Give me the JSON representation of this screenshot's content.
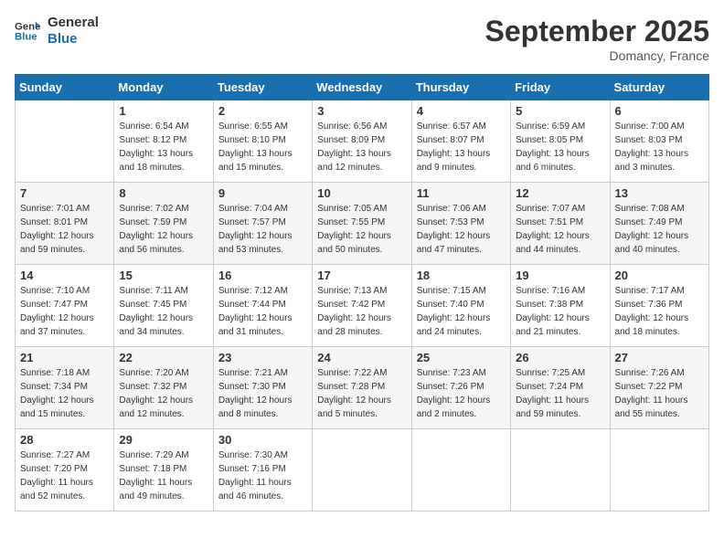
{
  "header": {
    "logo_line1": "General",
    "logo_line2": "Blue",
    "month": "September 2025",
    "location": "Domancy, France"
  },
  "days_of_week": [
    "Sunday",
    "Monday",
    "Tuesday",
    "Wednesday",
    "Thursday",
    "Friday",
    "Saturday"
  ],
  "weeks": [
    [
      {
        "day": "",
        "info": ""
      },
      {
        "day": "1",
        "info": "Sunrise: 6:54 AM\nSunset: 8:12 PM\nDaylight: 13 hours\nand 18 minutes."
      },
      {
        "day": "2",
        "info": "Sunrise: 6:55 AM\nSunset: 8:10 PM\nDaylight: 13 hours\nand 15 minutes."
      },
      {
        "day": "3",
        "info": "Sunrise: 6:56 AM\nSunset: 8:09 PM\nDaylight: 13 hours\nand 12 minutes."
      },
      {
        "day": "4",
        "info": "Sunrise: 6:57 AM\nSunset: 8:07 PM\nDaylight: 13 hours\nand 9 minutes."
      },
      {
        "day": "5",
        "info": "Sunrise: 6:59 AM\nSunset: 8:05 PM\nDaylight: 13 hours\nand 6 minutes."
      },
      {
        "day": "6",
        "info": "Sunrise: 7:00 AM\nSunset: 8:03 PM\nDaylight: 13 hours\nand 3 minutes."
      }
    ],
    [
      {
        "day": "7",
        "info": "Sunrise: 7:01 AM\nSunset: 8:01 PM\nDaylight: 12 hours\nand 59 minutes."
      },
      {
        "day": "8",
        "info": "Sunrise: 7:02 AM\nSunset: 7:59 PM\nDaylight: 12 hours\nand 56 minutes."
      },
      {
        "day": "9",
        "info": "Sunrise: 7:04 AM\nSunset: 7:57 PM\nDaylight: 12 hours\nand 53 minutes."
      },
      {
        "day": "10",
        "info": "Sunrise: 7:05 AM\nSunset: 7:55 PM\nDaylight: 12 hours\nand 50 minutes."
      },
      {
        "day": "11",
        "info": "Sunrise: 7:06 AM\nSunset: 7:53 PM\nDaylight: 12 hours\nand 47 minutes."
      },
      {
        "day": "12",
        "info": "Sunrise: 7:07 AM\nSunset: 7:51 PM\nDaylight: 12 hours\nand 44 minutes."
      },
      {
        "day": "13",
        "info": "Sunrise: 7:08 AM\nSunset: 7:49 PM\nDaylight: 12 hours\nand 40 minutes."
      }
    ],
    [
      {
        "day": "14",
        "info": "Sunrise: 7:10 AM\nSunset: 7:47 PM\nDaylight: 12 hours\nand 37 minutes."
      },
      {
        "day": "15",
        "info": "Sunrise: 7:11 AM\nSunset: 7:45 PM\nDaylight: 12 hours\nand 34 minutes."
      },
      {
        "day": "16",
        "info": "Sunrise: 7:12 AM\nSunset: 7:44 PM\nDaylight: 12 hours\nand 31 minutes."
      },
      {
        "day": "17",
        "info": "Sunrise: 7:13 AM\nSunset: 7:42 PM\nDaylight: 12 hours\nand 28 minutes."
      },
      {
        "day": "18",
        "info": "Sunrise: 7:15 AM\nSunset: 7:40 PM\nDaylight: 12 hours\nand 24 minutes."
      },
      {
        "day": "19",
        "info": "Sunrise: 7:16 AM\nSunset: 7:38 PM\nDaylight: 12 hours\nand 21 minutes."
      },
      {
        "day": "20",
        "info": "Sunrise: 7:17 AM\nSunset: 7:36 PM\nDaylight: 12 hours\nand 18 minutes."
      }
    ],
    [
      {
        "day": "21",
        "info": "Sunrise: 7:18 AM\nSunset: 7:34 PM\nDaylight: 12 hours\nand 15 minutes."
      },
      {
        "day": "22",
        "info": "Sunrise: 7:20 AM\nSunset: 7:32 PM\nDaylight: 12 hours\nand 12 minutes."
      },
      {
        "day": "23",
        "info": "Sunrise: 7:21 AM\nSunset: 7:30 PM\nDaylight: 12 hours\nand 8 minutes."
      },
      {
        "day": "24",
        "info": "Sunrise: 7:22 AM\nSunset: 7:28 PM\nDaylight: 12 hours\nand 5 minutes."
      },
      {
        "day": "25",
        "info": "Sunrise: 7:23 AM\nSunset: 7:26 PM\nDaylight: 12 hours\nand 2 minutes."
      },
      {
        "day": "26",
        "info": "Sunrise: 7:25 AM\nSunset: 7:24 PM\nDaylight: 11 hours\nand 59 minutes."
      },
      {
        "day": "27",
        "info": "Sunrise: 7:26 AM\nSunset: 7:22 PM\nDaylight: 11 hours\nand 55 minutes."
      }
    ],
    [
      {
        "day": "28",
        "info": "Sunrise: 7:27 AM\nSunset: 7:20 PM\nDaylight: 11 hours\nand 52 minutes."
      },
      {
        "day": "29",
        "info": "Sunrise: 7:29 AM\nSunset: 7:18 PM\nDaylight: 11 hours\nand 49 minutes."
      },
      {
        "day": "30",
        "info": "Sunrise: 7:30 AM\nSunset: 7:16 PM\nDaylight: 11 hours\nand 46 minutes."
      },
      {
        "day": "",
        "info": ""
      },
      {
        "day": "",
        "info": ""
      },
      {
        "day": "",
        "info": ""
      },
      {
        "day": "",
        "info": ""
      }
    ]
  ]
}
